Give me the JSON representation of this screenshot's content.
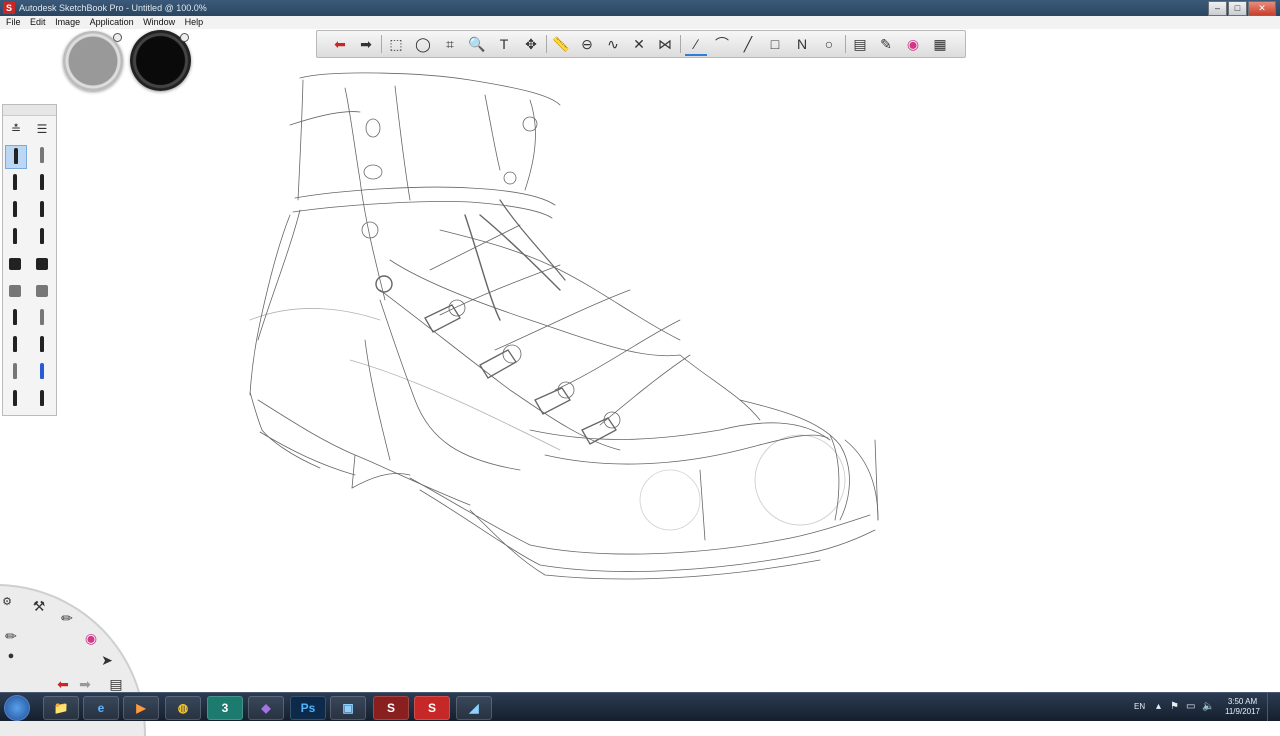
{
  "window": {
    "title": "Autodesk SketchBook Pro - Untitled @ 100.0%",
    "app_icon_letter": "S",
    "buttons": {
      "minimize": "–",
      "maximize": "□",
      "close": "✕"
    }
  },
  "menu": [
    "File",
    "Edit",
    "Image",
    "Application",
    "Window",
    "Help"
  ],
  "toolbar": {
    "tools": [
      {
        "name": "undo-icon",
        "glyph": "⬅"
      },
      {
        "name": "redo-icon",
        "glyph": "➡"
      },
      {
        "name": "rect-select-icon",
        "glyph": "⬚"
      },
      {
        "name": "lasso-icon",
        "glyph": "◯"
      },
      {
        "name": "crop-icon",
        "glyph": "⌗"
      },
      {
        "name": "zoom-icon",
        "glyph": "🔍"
      },
      {
        "name": "text-icon",
        "glyph": "T"
      },
      {
        "name": "move-icon",
        "glyph": "✥"
      },
      {
        "name": "ruler-icon",
        "glyph": "📏"
      },
      {
        "name": "ellipse-guide-icon",
        "glyph": "⊖"
      },
      {
        "name": "french-curve-icon",
        "glyph": "∿"
      },
      {
        "name": "symmetry-icon",
        "glyph": "✕"
      },
      {
        "name": "mirror-icon",
        "glyph": "⋈"
      },
      {
        "name": "stroke-icon",
        "glyph": "∕"
      },
      {
        "name": "curve-icon",
        "glyph": "⌒"
      },
      {
        "name": "line-icon",
        "glyph": "╱"
      },
      {
        "name": "rectangle-icon",
        "glyph": "□"
      },
      {
        "name": "polyline-icon",
        "glyph": "N"
      },
      {
        "name": "circle-icon",
        "glyph": "○"
      },
      {
        "name": "layers-icon",
        "glyph": "▤"
      },
      {
        "name": "brushes-icon",
        "glyph": "✎"
      },
      {
        "name": "color-wheel-icon",
        "glyph": "◉"
      },
      {
        "name": "swatches-icon",
        "glyph": "▦"
      }
    ],
    "active_tool": "stroke-icon"
  },
  "pucks": {
    "size_puck": "grey",
    "color_puck": "black"
  },
  "brush_palette": {
    "header_buttons": [
      {
        "name": "brush-properties-icon",
        "glyph": "≛"
      },
      {
        "name": "brush-library-icon",
        "glyph": "☰"
      }
    ],
    "brushes": 20,
    "selected_index": 0
  },
  "lagoon": {
    "items": [
      {
        "name": "settings-icon",
        "glyph": "⚙"
      },
      {
        "name": "brush-tools-icon",
        "glyph": "⚒"
      },
      {
        "name": "pencil-icon",
        "glyph": "✏"
      },
      {
        "name": "color-icon",
        "glyph": "◉"
      },
      {
        "name": "brush-size-icon",
        "glyph": "●"
      },
      {
        "name": "select-icon",
        "glyph": "➤"
      },
      {
        "name": "lagoon-undo-icon",
        "glyph": "⬅"
      },
      {
        "name": "lagoon-redo-icon",
        "glyph": "➡"
      },
      {
        "name": "lagoon-layers-icon",
        "glyph": "▤"
      }
    ]
  },
  "taskbar": {
    "apps": [
      {
        "name": "file-explorer-icon",
        "label": "📁"
      },
      {
        "name": "internet-explorer-icon",
        "label": "e"
      },
      {
        "name": "media-player-icon",
        "label": "▶"
      },
      {
        "name": "chrome-icon",
        "label": "◍"
      },
      {
        "name": "3ds-max-icon",
        "label": "3"
      },
      {
        "name": "visual-studio-icon",
        "label": "◆"
      },
      {
        "name": "photoshop-icon",
        "label": "Ps"
      },
      {
        "name": "control-panel-icon",
        "label": "▣"
      },
      {
        "name": "sketchbook-alt-icon",
        "label": "S"
      },
      {
        "name": "sketchbook-icon",
        "label": "S"
      },
      {
        "name": "app-icon",
        "label": "◢"
      }
    ],
    "language": "EN",
    "time": "3:50 AM",
    "date": "11/9/2017"
  },
  "colors": {
    "accent": "#2c7fd6",
    "taskbar": "#1c2a3c",
    "undo": "#c62828"
  }
}
